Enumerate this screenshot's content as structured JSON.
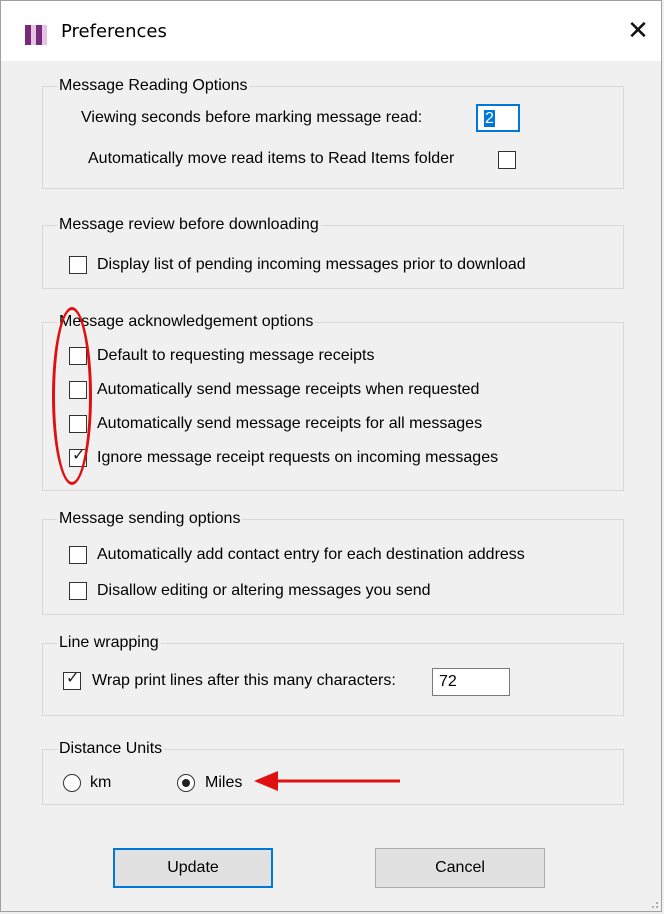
{
  "window": {
    "title": "Preferences",
    "close_glyph": "✕"
  },
  "reading": {
    "title": "Message Reading Options",
    "seconds_label": "Viewing seconds before marking message read:",
    "seconds_value": "2",
    "move_label": "Automatically move read items to Read Items folder",
    "move_checked": false
  },
  "review": {
    "title": "Message review before downloading",
    "display_label": "Display list of pending incoming messages prior to download",
    "display_checked": false
  },
  "ack": {
    "title": "Message acknowledgement options",
    "items": [
      {
        "label": "Default to requesting message receipts",
        "checked": false
      },
      {
        "label": "Automatically send message receipts when requested",
        "checked": false
      },
      {
        "label": "Automatically send message receipts for all messages",
        "checked": false
      },
      {
        "label": "Ignore message receipt requests on incoming messages",
        "checked": true
      }
    ]
  },
  "sending": {
    "title": "Message sending options",
    "items": [
      {
        "label": "Automatically add contact entry for each destination address",
        "checked": false
      },
      {
        "label": "Disallow editing or altering messages you send",
        "checked": false
      }
    ]
  },
  "wrapping": {
    "title": "Line wrapping",
    "wrap_label": "Wrap print lines after this many characters:",
    "wrap_checked": true,
    "wrap_value": "72"
  },
  "distance": {
    "title": "Distance Units",
    "options": [
      {
        "label": "km",
        "selected": false
      },
      {
        "label": "Miles",
        "selected": true
      }
    ]
  },
  "buttons": {
    "update": "Update",
    "cancel": "Cancel"
  },
  "colors": {
    "annotation": "#e01010",
    "focus": "#0078d7"
  },
  "icons": {
    "app": "checkered-app-icon",
    "check": "checkmark-icon"
  }
}
